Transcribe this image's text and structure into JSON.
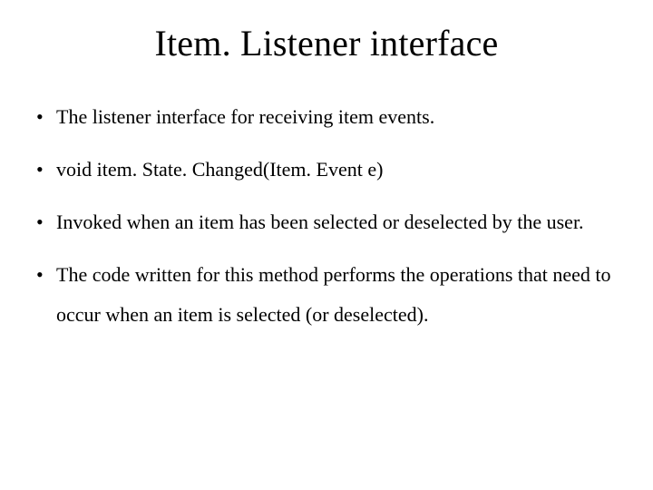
{
  "title": "Item. Listener interface",
  "bullets": [
    "The listener interface for receiving item events.",
    "void item. State. Changed(Item. Event e)",
    "Invoked when an item has been selected or deselected by the user.",
    "The code written for this method performs the operations that need to occur when an item is selected (or deselected)."
  ]
}
